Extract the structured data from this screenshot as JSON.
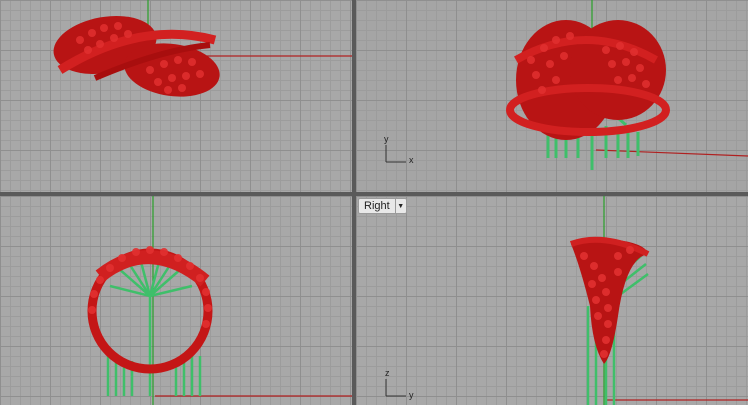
{
  "viewports": {
    "right": {
      "label": "Right",
      "dropdown_icon": "chevron-down-icon"
    },
    "perspective": {
      "axis_x": "x",
      "axis_y": "y"
    },
    "right_axes": {
      "axis_y": "y",
      "axis_z": "z"
    }
  },
  "colors": {
    "gem": "#c81a1a",
    "band": "#c01414",
    "support": "#3fbf6a",
    "axis_x": "#b02020",
    "axis_y": "#2aa02a",
    "grid_bg": "#a8a8a8"
  }
}
